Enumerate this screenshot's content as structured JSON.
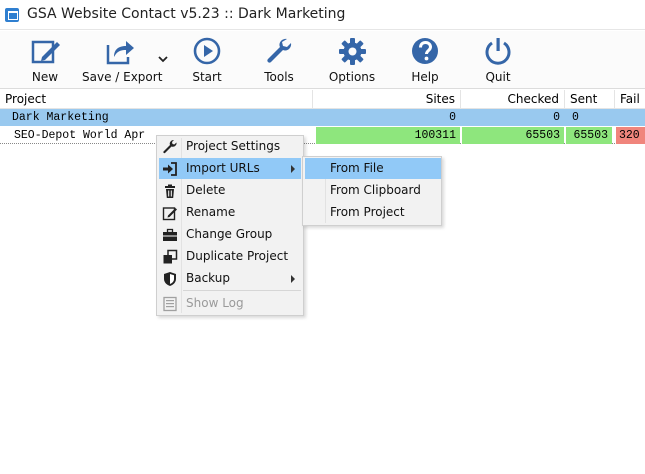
{
  "window": {
    "title": "GSA Website Contact v5.23 :: Dark Marketing"
  },
  "toolbar": {
    "new_label": "New",
    "save_export_label": "Save / Export",
    "start_label": "Start",
    "tools_label": "Tools",
    "options_label": "Options",
    "help_label": "Help",
    "quit_label": "Quit",
    "icon_color": "#3566a8"
  },
  "table": {
    "columns": [
      "Project",
      "Sites",
      "Checked",
      "Sent",
      "Fail"
    ],
    "rows": [
      {
        "project": "Dark Marketing",
        "sites": "0",
        "checked": "0",
        "sent": "0",
        "fail": ""
      },
      {
        "project": "SEO-Depot World Apr",
        "sites": "100311",
        "checked": "65503",
        "sent": "65503",
        "fail": "320"
      }
    ]
  },
  "context_menu": {
    "items": [
      {
        "label": "Project Settings",
        "icon": "wrench-icon"
      },
      {
        "label": "Import URLs",
        "icon": "import-icon",
        "submenu": true,
        "highlighted": true
      },
      {
        "label": "Delete",
        "icon": "trash-icon"
      },
      {
        "label": "Rename",
        "icon": "edit-icon"
      },
      {
        "label": "Change Group",
        "icon": "briefcase-icon"
      },
      {
        "label": "Duplicate Project",
        "icon": "duplicate-icon"
      },
      {
        "label": "Backup",
        "icon": "shield-icon",
        "submenu": true
      },
      {
        "label": "Show Log",
        "icon": "log-icon",
        "disabled": true
      }
    ]
  },
  "submenu": {
    "items": [
      {
        "label": "From File",
        "highlighted": true
      },
      {
        "label": "From Clipboard"
      },
      {
        "label": "From Project"
      }
    ]
  },
  "colors": {
    "selected_row": "#99c9ef",
    "green_cell": "#8ee67d",
    "red_cell": "#f0857c",
    "menu_highlight": "#91c9f7"
  }
}
